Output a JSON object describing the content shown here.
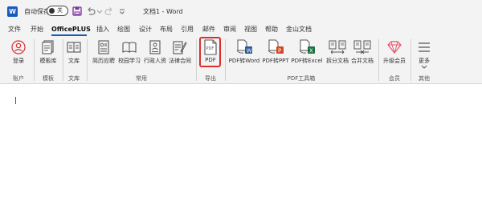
{
  "titlebar": {
    "app_logo": "W",
    "autosave_label": "自动保存",
    "autosave_state": "关",
    "doc_title": "文档1 - Word",
    "icons": [
      "save-icon",
      "undo-icon",
      "redo-icon",
      "customize-icon"
    ]
  },
  "menu": {
    "items": [
      "文件",
      "开始",
      "OfficePLUS",
      "插入",
      "绘图",
      "设计",
      "布局",
      "引用",
      "邮件",
      "审阅",
      "视图",
      "帮助",
      "金山文档"
    ],
    "active": "OfficePLUS"
  },
  "ribbon": {
    "buttons": [
      {
        "label": "登录",
        "icon": "user-icon"
      },
      {
        "label": "模板库",
        "icon": "template-icon"
      },
      {
        "label": "文库",
        "icon": "library-icon"
      },
      {
        "label": "简历应聘",
        "icon": "resume-icon"
      },
      {
        "label": "校园学习",
        "icon": "campus-icon"
      },
      {
        "label": "行政人资",
        "icon": "admin-icon"
      },
      {
        "label": "法律合同",
        "icon": "legal-icon"
      },
      {
        "label": "PDF",
        "icon": "pdf-icon"
      },
      {
        "label": "PDF转Word",
        "icon": "pdf-to-word-icon"
      },
      {
        "label": "PDF转PPT",
        "icon": "pdf-to-ppt-icon"
      },
      {
        "label": "PDF转Excel",
        "icon": "pdf-to-excel-icon"
      },
      {
        "label": "拆分文档",
        "icon": "split-doc-icon"
      },
      {
        "label": "合并文档",
        "icon": "merge-doc-icon"
      },
      {
        "label": "升级会员",
        "icon": "upgrade-icon"
      },
      {
        "label": "更多",
        "icon": "more-icon"
      }
    ],
    "groups": [
      "账户",
      "模板",
      "文库",
      "常用",
      "导出",
      "PDF工具箱",
      "会员",
      "其他"
    ],
    "pdf_icon_text": "PDF",
    "badges": {
      "word": "W",
      "ppt": "P",
      "excel": "X"
    },
    "colors": {
      "accent": "#185abd",
      "highlight": "#d9302c",
      "word": "#2b5797",
      "ppt": "#d24726",
      "excel": "#1e7145",
      "upgrade": "#e0566c"
    }
  }
}
